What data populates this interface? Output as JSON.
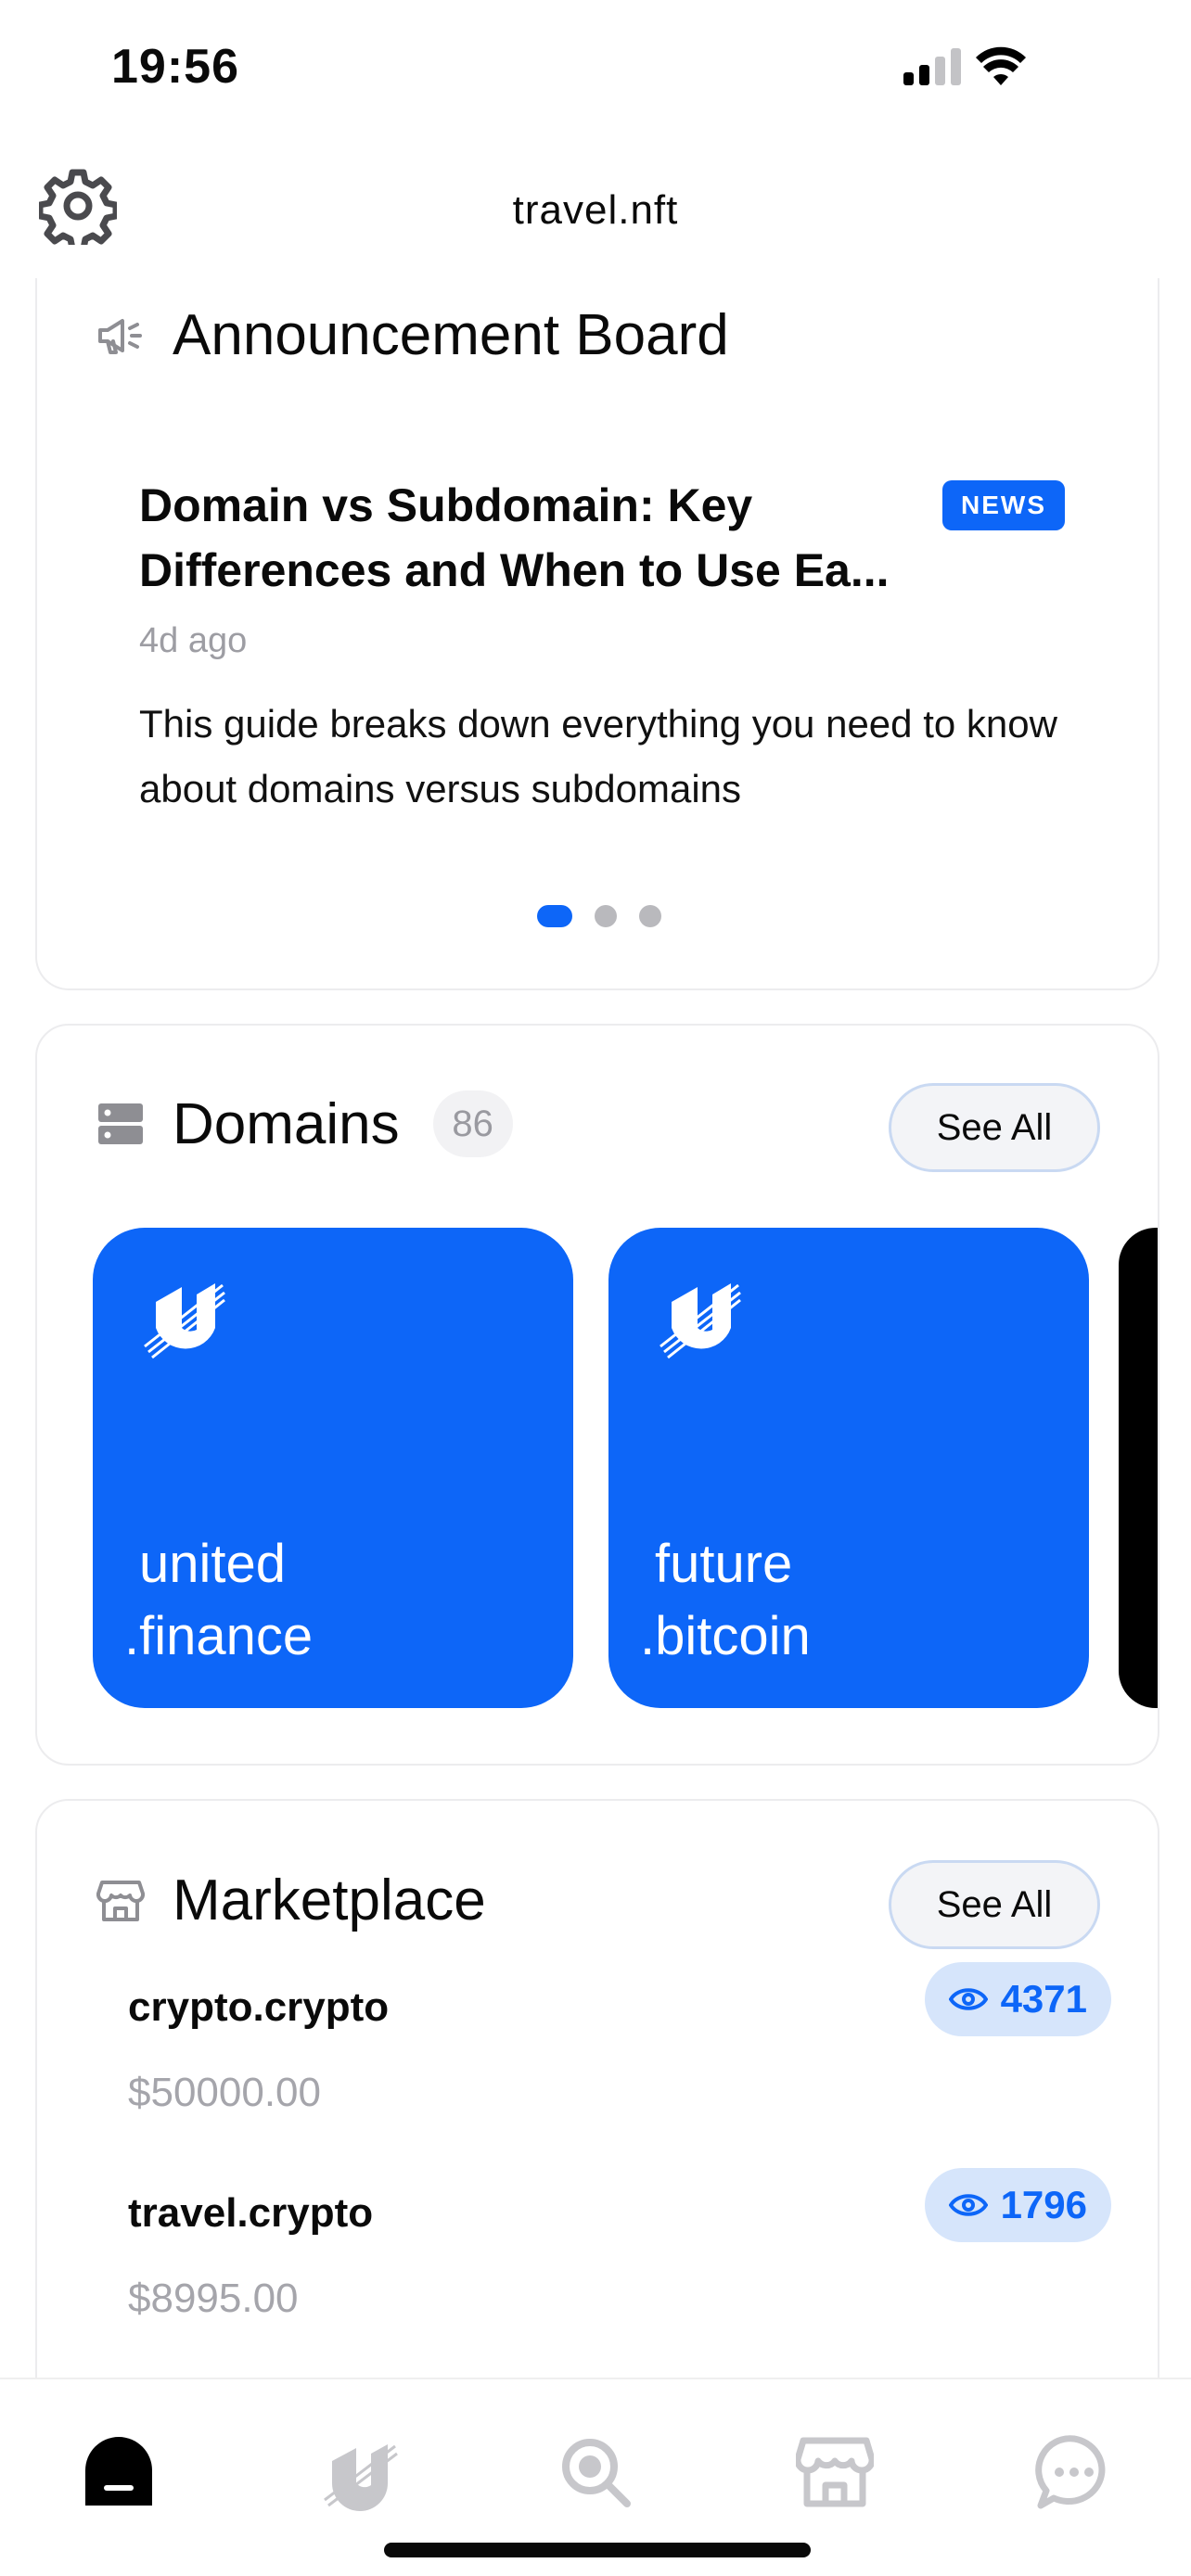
{
  "status_bar": {
    "time": "19:56"
  },
  "header": {
    "title": "travel.nft"
  },
  "announcements": {
    "title": "Announcement Board",
    "item": {
      "title": "Domain vs Subdomain: Key\nDifferences and When to Use Ea...",
      "badge": "NEWS",
      "time": "4d ago",
      "body": "This guide breaks down everything you need to know about domains versus subdomains"
    },
    "pages_total": 3,
    "page_active": 1
  },
  "domains": {
    "title": "Domains",
    "count": "86",
    "see_all": "See All",
    "items": [
      {
        "line1": "united",
        "line2": ".finance"
      },
      {
        "line1": "future",
        "line2": ".bitcoin"
      }
    ]
  },
  "marketplace": {
    "title": "Marketplace",
    "see_all": "See All",
    "items": [
      {
        "name": "crypto.crypto",
        "price": "$50000.00",
        "views": "4371"
      },
      {
        "name": "travel.crypto",
        "price": "$8995.00",
        "views": "1796"
      }
    ]
  },
  "tabs": [
    {
      "name": "home",
      "active": true
    },
    {
      "name": "domains",
      "active": false
    },
    {
      "name": "explore",
      "active": false
    },
    {
      "name": "marketplace",
      "active": false
    },
    {
      "name": "messages",
      "active": false
    }
  ],
  "colors": {
    "accent": "#0d66f8",
    "muted": "#9d9da3",
    "badge_bg": "#d6e5fb"
  }
}
